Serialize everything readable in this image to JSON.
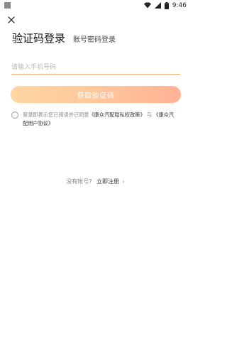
{
  "status_bar": {
    "time": "9:46",
    "icons": [
      "wifi-icon",
      "signal-icon",
      "battery-icon"
    ]
  },
  "nav": {
    "close_icon": "close-icon"
  },
  "title": {
    "main": "验证码登录",
    "alt_tab": "账号密码登录"
  },
  "phone": {
    "placeholder": "请输入手机号码",
    "value": ""
  },
  "get_code_button": {
    "label": "获取验证码"
  },
  "agreement": {
    "prefix": "登录即表示您已阅读并已同意",
    "privacy_link": "《康众汽配隐私权政策》",
    "joiner": "与",
    "user_link": "《康众汽配用户协议》"
  },
  "register": {
    "question": "没有帐号?",
    "link": "立即注册",
    "chevron": "›"
  },
  "colors": {
    "accent": "#f4b073",
    "button_start": "#ffd6a0",
    "button_end": "#ffb296"
  }
}
